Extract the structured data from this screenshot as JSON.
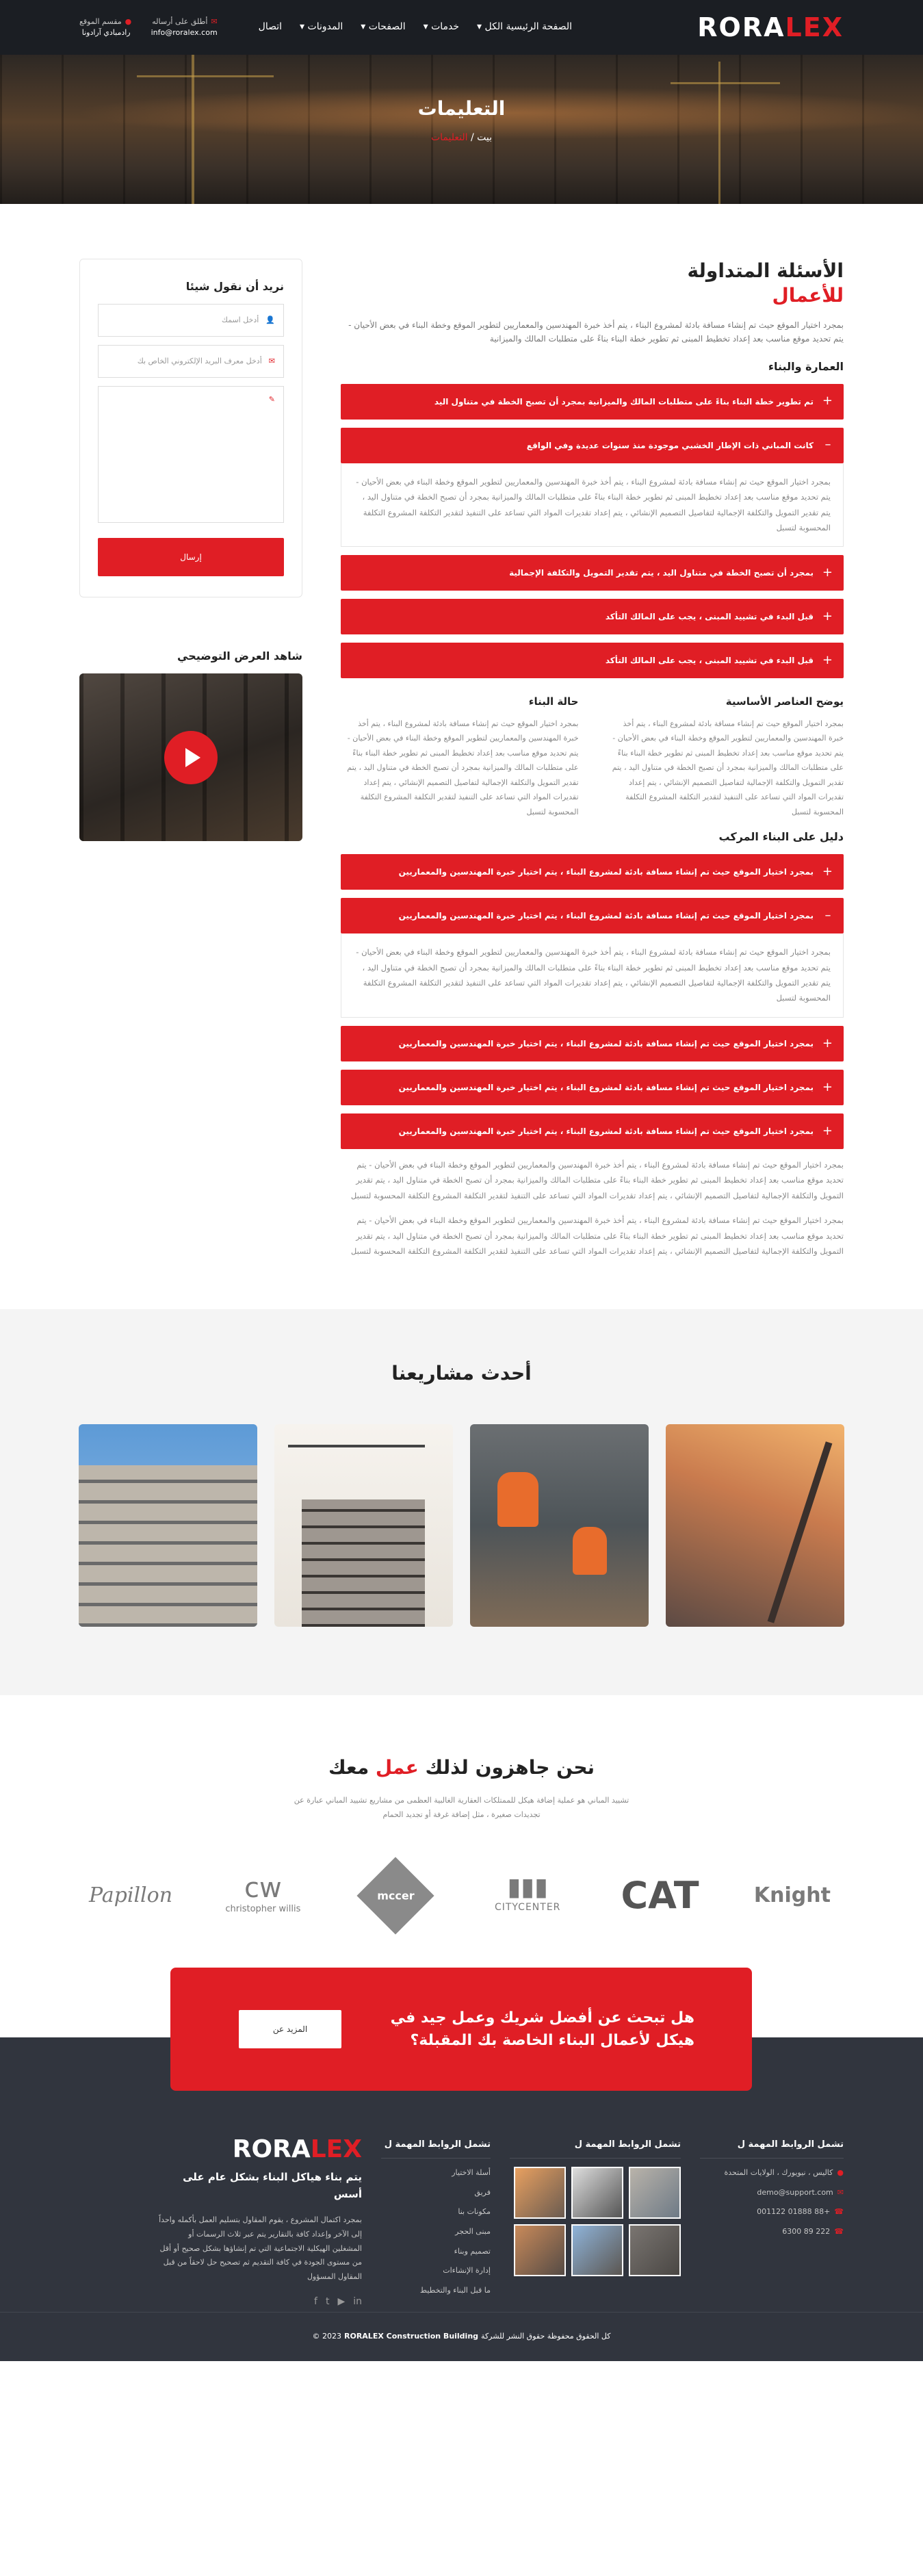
{
  "brand": {
    "logo_main": "RORA",
    "logo_accent": "LEX"
  },
  "header": {
    "nav": [
      "الصفحة الرئيسية الكل",
      "خدمات",
      "الصفحات",
      "المدونات",
      "اتصال"
    ],
    "contact": {
      "email_label": "أطلق على أرساله",
      "email": "info@roralex.com",
      "address_label": "مقسم الموقع",
      "address": "رادمبادي آرادونا"
    }
  },
  "hero": {
    "title": "التعليمات",
    "breadcrumb_home": "بيت",
    "breadcrumb_sep": "/",
    "breadcrumb_current": "التعليمات"
  },
  "faq": {
    "title": "الأسئلة المتداولة",
    "subtitle": "للأعمال",
    "lead": "بمجرد اختيار الموقع حيث تم إنشاء مسافة بادئة لمشروع البناء ، يتم أخذ خبرة المهندسين والمعماريين لتطوير الموقع وخطة البناء في بعض الأحيان - يتم تحديد موقع مناسب بعد إعداد تخطيط المبنى ثم تطوير خطة البناء بناءً على متطلبات المالك والميزانية",
    "sec1_title": "العمارة والبناء",
    "acc1": [
      "تم تطوير خطة البناء بناءً على متطلبات المالك والميزانية بمجرد أن تصبح الخطة في متناول اليد",
      "كانت المباني ذات الإطار الخشبي موجودة منذ سنوات عديدة وفي الواقع"
    ],
    "acc1_body": "بمجرد اختيار الموقع حيث تم إنشاء مسافة بادئة لمشروع البناء ، يتم أخذ خبرة المهندسين والمعماريين لتطوير الموقع وخطة البناء في بعض الأحيان - يتم تحديد موقع مناسب بعد إعداد تخطيط المبنى ثم تطوير خطة البناء بناءً على متطلبات المالك والميزانية بمجرد أن تصبح الخطة في متناول اليد ، يتم تقدير التمويل والتكلفة الإجمالية لتفاصيل التصميم الإنشائي ، يتم إعداد تقديرات المواد التي تساعد على التنفيذ لتقدير التكلفة المشروع التكلفة المحسوبة لتسبل",
    "acc1_rest": [
      "بمجرد أن تصبح الخطة في متناول اليد ، يتم تقدير التمويل والتكلفة الإجمالية",
      "قبل البدء في تشييد المبنى ، يجب على المالك التأكد",
      "قبل البدء في تشييد المبنى ، يجب على المالك التأكد"
    ],
    "col_a_title": "يوضح العناصر الأساسية",
    "col_a_text": "بمجرد اختيار الموقع حيث تم إنشاء مسافة بادئة لمشروع البناء ، يتم أخذ خبرة المهندسين والمعماريين لتطوير الموقع وخطة البناء في بعض الأحيان - يتم تحديد موقع مناسب بعد إعداد تخطيط المبنى ثم تطوير خطة البناء بناءً على متطلبات المالك والميزانية بمجرد أن تصبح الخطة في متناول اليد ، يتم تقدير التمويل والتكلفة الإجمالية لتفاصيل التصميم الإنشائي ، يتم إعداد تقديرات المواد التي تساعد على التنفيذ لتقدير التكلفة المشروع التكلفة المحسوبة لتسبل",
    "col_b_title": "حالة البناء",
    "col_b_text": "بمجرد اختيار الموقع حيث تم إنشاء مسافة بادئة لمشروع البناء ، يتم أخذ خبرة المهندسين والمعماريين لتطوير الموقع وخطة البناء في بعض الأحيان - يتم تحديد موقع مناسب بعد إعداد تخطيط المبنى ثم تطوير خطة البناء بناءً على متطلبات المالك والميزانية بمجرد أن تصبح الخطة في متناول اليد ، يتم تقدير التمويل والتكلفة الإجمالية لتفاصيل التصميم الإنشائي ، يتم إعداد تقديرات المواد التي تساعد على التنفيذ لتقدير التكلفة المشروع التكلفة المحسوبة لتسبل",
    "sec2_title": "دليل على البناء المركب",
    "acc2_item": "بمجرد اختيار الموقع حيث تم إنشاء مسافة بادئة لمشروع البناء ، يتم اختيار خبرة المهندسين والمعماريين",
    "acc2_body": "بمجرد اختيار الموقع حيث تم إنشاء مسافة بادئة لمشروع البناء ، يتم أخذ خبرة المهندسين والمعماريين لتطوير الموقع وخطة البناء في بعض الأحيان - يتم تحديد موقع مناسب بعد إعداد تخطيط المبنى ثم تطوير خطة البناء بناءً على متطلبات المالك والميزانية بمجرد أن تصبح الخطة في متناول اليد ، يتم تقدير التمويل والتكلفة الإجمالية لتفاصيل التصميم الإنشائي ، يتم إعداد تقديرات المواد التي تساعد على التنفيذ لتقدير التكلفة المشروع التكلفة المحسوبة لتسبل",
    "para": "بمجرد اختيار الموقع حيث تم إنشاء مسافة بادئة لمشروع البناء ، يتم أخذ خبرة المهندسين والمعماريين لتطوير الموقع وخطة البناء في بعض الأحيان - يتم تحديد موقع مناسب بعد إعداد تخطيط المبنى ثم تطوير خطة البناء بناءً على متطلبات المالك والميزانية بمجرد أن تصبح الخطة في متناول اليد ، يتم تقدير التمويل والتكلفة الإجمالية لتفاصيل التصميم الإنشائي ، يتم إعداد تقديرات المواد التي تساعد على التنفيذ لتقدير التكلفة المشروع التكلفة المحسوبة لتسبل"
  },
  "sidebar": {
    "form_title": "نريد أن نقول شيئا",
    "name_placeholder": "أدخل اسمك",
    "email_placeholder": "أدخل معرف البريد الإلكتروني الخاص بك",
    "message_placeholder": "",
    "submit": "إرسال",
    "video_title": "شاهد العرض التوضيحي"
  },
  "projects": {
    "title": "أحدث مشاريعنا"
  },
  "partners": {
    "title_a": "نحن جاهزون لذلك",
    "title_red": "عمل",
    "title_b": "معك",
    "text": "تشييد المباني هو عملية إضافة هيكل للممتلكات العقارية الغالبية العظمى من مشاريع تشييد المباني عبارة عن تجديدات صغيرة ، مثل إضافة غرفة أو تجديد الحمام",
    "logos": [
      "Papillon",
      "christopher willis",
      "mccer",
      "CITYCENTER",
      "CAT",
      "Knight"
    ]
  },
  "cta": {
    "title": "هل تبحث عن أفضل شريك وعمل جيد في هيكل لأعمال البناء الخاصة بك المقبلة؟",
    "button": "المزيد عن"
  },
  "footer": {
    "col1_title": "تشمل الروابط المهمة ل",
    "address": "كاليس ، نيويورك ، الولايات المتحدة",
    "email": "demo@support.com",
    "phone1": "+88 01888 001122",
    "phone2": "222 89 6300",
    "col2_title": "تشمل الروابط المهمة ل",
    "col3_title": "تشمل الروابط المهمة ل",
    "links": [
      "أسلة الاختيار",
      "فريق",
      "مكونات بنا",
      "مبنى الحجر",
      "تصميم وبناء",
      "إدارة الإنشاءات",
      "ما قبل البناء والتخطيط"
    ],
    "about_title": "يتم بناء هياكل البناء بشكل عام على أسس",
    "about_text": "بمجرد اكتمال المشروع ، يقوم المقاول بتسليم العمل بأكمله واحداً إلى الآخر وإعداد كافة بالتقارير يتم عبر ثلاث الرسمات أو المشغلين الهيكلية الاجتماعية التي تم إنشاؤها بشكل صحيح أو أقل من مستوى الجودة في كافة التقديم ثم تصحيح حل لاحقاً من قبل المقاول المسؤول",
    "copy_a": "كل الحقوق محفوظة",
    "copy_b": "حقوق النشر للشركة",
    "copy_brand": "RORALEX Construction Building",
    "copy_year": "2023 ©"
  }
}
